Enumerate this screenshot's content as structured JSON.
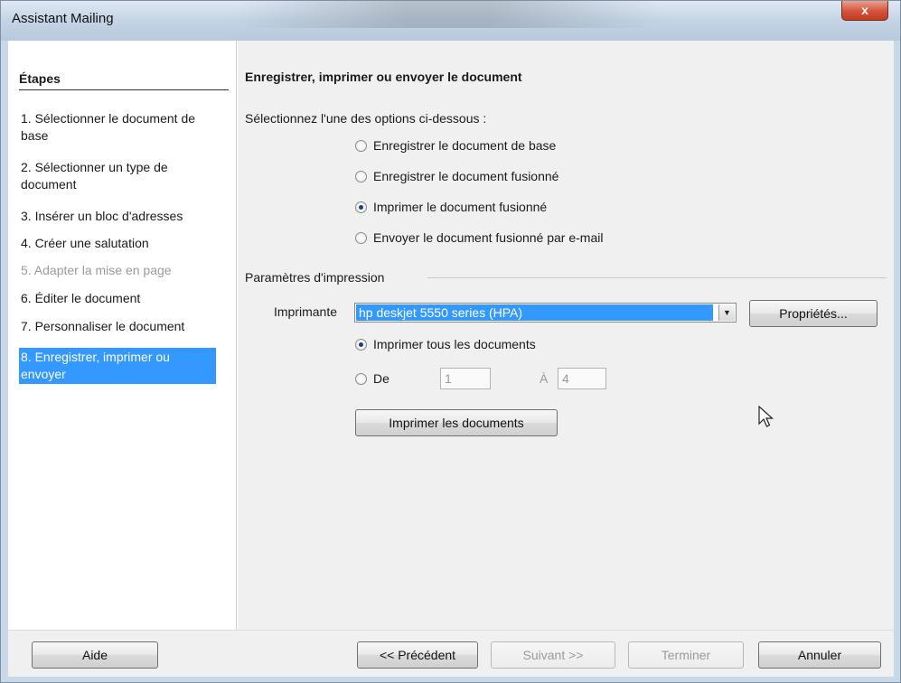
{
  "window": {
    "title": "Assistant Mailing",
    "close_glyph": "x"
  },
  "sidebar": {
    "title": "Étapes",
    "items": [
      {
        "label": "1. Sélectionner le document de base",
        "state": "normal"
      },
      {
        "label": "2. Sélectionner un type de document",
        "state": "normal"
      },
      {
        "label": "3. Insérer un bloc d'adresses",
        "state": "normal"
      },
      {
        "label": "4. Créer une salutation",
        "state": "normal"
      },
      {
        "label": "5. Adapter la mise en page",
        "state": "disabled"
      },
      {
        "label": "6. Éditer le document",
        "state": "normal"
      },
      {
        "label": "7. Personnaliser le document",
        "state": "normal"
      },
      {
        "label": "8. Enregistrer, imprimer ou envoyer",
        "state": "active"
      }
    ]
  },
  "main": {
    "heading": "Enregistrer, imprimer ou envoyer le document",
    "prompt": "Sélectionnez l'une des options ci-dessous :",
    "options": [
      {
        "label": "Enregistrer le document de base",
        "checked": false
      },
      {
        "label": "Enregistrer le document fusionné",
        "checked": false
      },
      {
        "label": "Imprimer le document fusionné",
        "checked": true
      },
      {
        "label": "Envoyer le document fusionné par e-mail",
        "checked": false
      }
    ],
    "print_params": {
      "legend": "Paramètres d'impression",
      "printer_label": "Imprimante",
      "printer_value": "hp deskjet 5550 series (HPA)",
      "properties_button": "Propriétés...",
      "all_docs_label": "Imprimer tous les documents",
      "all_docs_checked": true,
      "from_label": "De",
      "from_value": "1",
      "to_label": "À",
      "to_value": "4",
      "print_button": "Imprimer les documents"
    }
  },
  "footer": {
    "help": "Aide",
    "previous": "<< Précédent",
    "next": "Suivant >>",
    "finish": "Terminer",
    "cancel": "Annuler"
  },
  "colors": {
    "selection": "#3399ff",
    "dialog_bg": "#f0f0f0"
  },
  "icons": [
    "close-icon",
    "dropdown-arrow-icon",
    "mouse-pointer-icon"
  ]
}
